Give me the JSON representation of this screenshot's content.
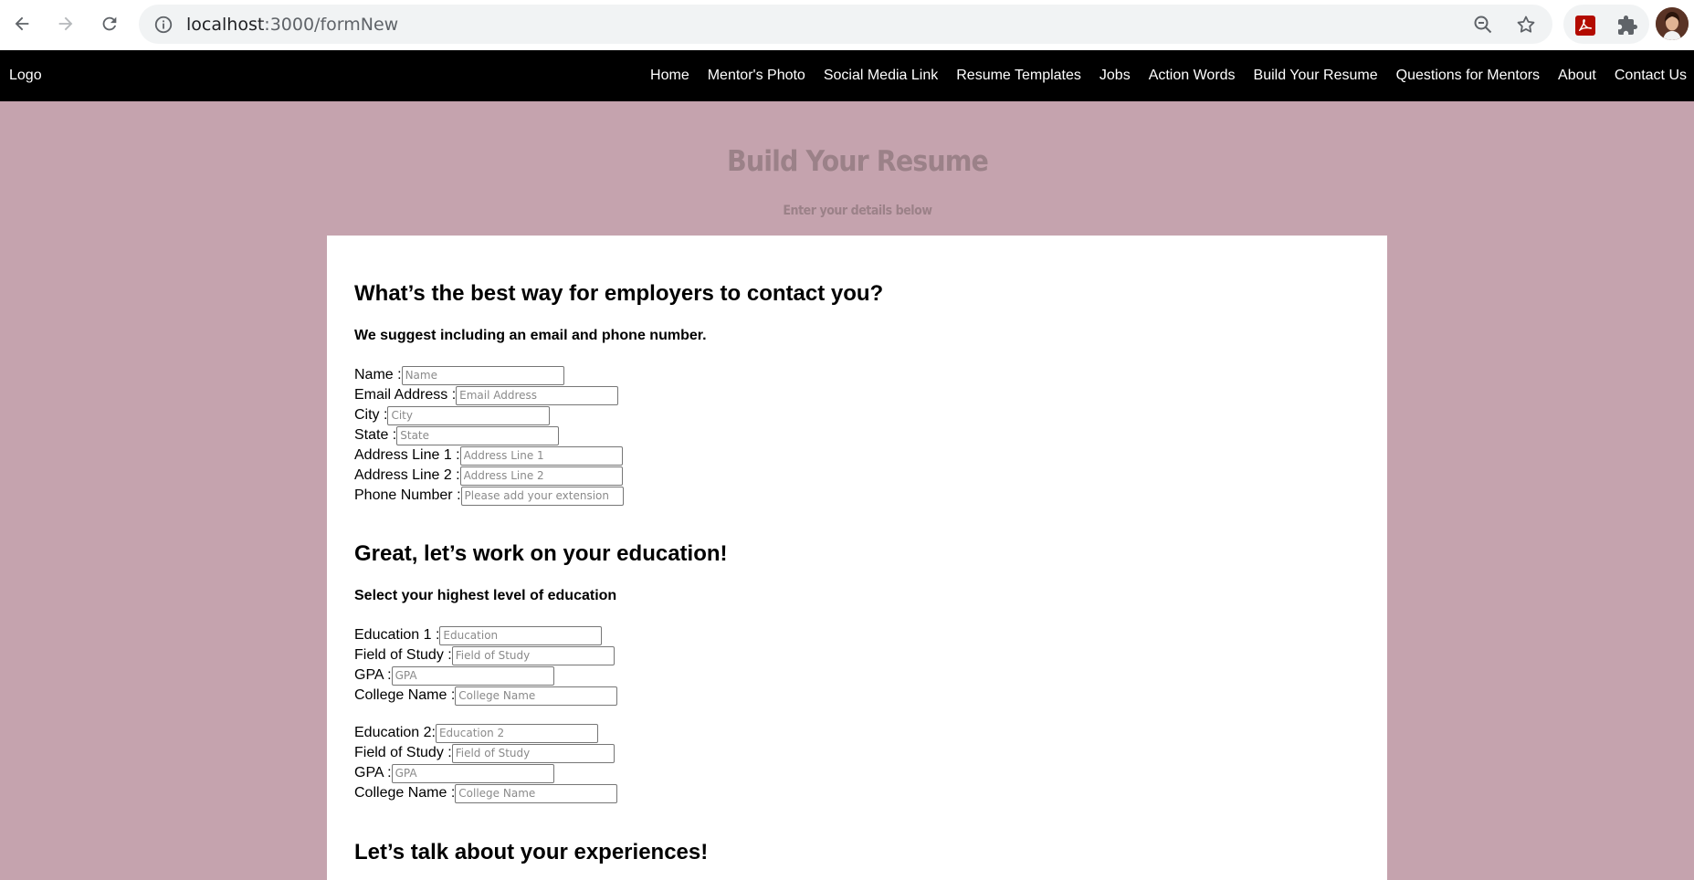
{
  "browser": {
    "url_host": "localhost",
    "url_path": ":3000/formNew"
  },
  "navbar": {
    "logo": "Logo",
    "links": [
      "Home",
      "Mentor's Photo",
      "Social Media Link",
      "Resume Templates",
      "Jobs",
      "Action Words",
      "Build Your Resume",
      "Questions for Mentors",
      "About",
      "Contact Us"
    ]
  },
  "hero": {
    "title": "Build Your Resume",
    "subtitle": "Enter your details below"
  },
  "contact": {
    "heading": "What’s the best way for employers to contact you?",
    "hint": "We suggest including an email and phone number.",
    "fields": [
      {
        "label": "Name :",
        "placeholder": "Name",
        "value": ""
      },
      {
        "label": "Email Address :",
        "placeholder": "Email Address",
        "value": ""
      },
      {
        "label": "City :",
        "placeholder": "City",
        "value": ""
      },
      {
        "label": "State :",
        "placeholder": "State",
        "value": ""
      },
      {
        "label": "Address Line 1 :",
        "placeholder": "Address Line 1",
        "value": ""
      },
      {
        "label": "Address Line 2 :",
        "placeholder": "Address Line 2",
        "value": ""
      },
      {
        "label": "Phone Number :",
        "placeholder": "Please add your extension",
        "value": ""
      }
    ]
  },
  "education": {
    "heading": "Great, let’s work on your education!",
    "hint": "Select your highest level of education",
    "group1": [
      {
        "label": "Education 1 :",
        "placeholder": "Education",
        "value": ""
      },
      {
        "label": "Field of Study :",
        "placeholder": "Field of Study",
        "value": ""
      },
      {
        "label": "GPA :",
        "placeholder": "GPA",
        "value": ""
      },
      {
        "label": "College Name :",
        "placeholder": "College Name",
        "value": ""
      }
    ],
    "group2": [
      {
        "label": "Education 2:",
        "placeholder": "Education 2",
        "value": ""
      },
      {
        "label": "Field of Study :",
        "placeholder": "Field of Study",
        "value": ""
      },
      {
        "label": "GPA :",
        "placeholder": "GPA",
        "value": ""
      },
      {
        "label": "College Name :",
        "placeholder": "College Name",
        "value": ""
      }
    ]
  },
  "experience": {
    "heading": "Let’s talk about your experiences!"
  },
  "colors": {
    "page_bg": "#c5a3ae",
    "navbar_bg": "#000000",
    "hero_text": "#9b8188"
  }
}
